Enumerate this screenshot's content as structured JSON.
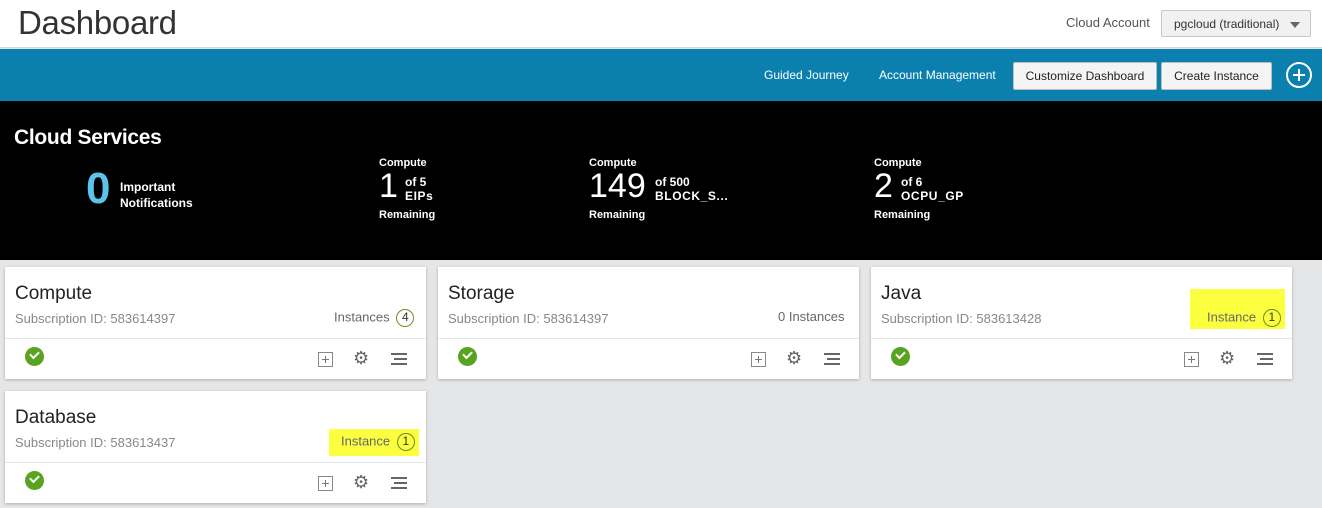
{
  "header": {
    "title": "Dashboard",
    "account_label": "Cloud Account",
    "account_value": "pgcloud (traditional)"
  },
  "nav": {
    "guided_journey": "Guided Journey",
    "account_management": "Account Management",
    "customize_dashboard": "Customize Dashboard",
    "create_instance": "Create Instance"
  },
  "banner": {
    "title": "Cloud Services",
    "notifications_count": "0",
    "notifications_line1": "Important",
    "notifications_line2": "Notifications",
    "metrics": [
      {
        "service": "Compute",
        "value": "1",
        "of": "of 5",
        "resource": "EIPs",
        "remaining": "Remaining"
      },
      {
        "service": "Compute",
        "value": "149",
        "of": "of 500",
        "resource": "BLOCK_S...",
        "remaining": "Remaining"
      },
      {
        "service": "Compute",
        "value": "2",
        "of": "of 6",
        "resource": "OCPU_GP",
        "remaining": "Remaining"
      }
    ]
  },
  "cards": [
    {
      "title": "Compute",
      "subscription": "Subscription ID: 583614397",
      "instances_label": "Instances",
      "instances_count": "4"
    },
    {
      "title": "Storage",
      "subscription": "Subscription ID: 583614397",
      "instances_label": "0 Instances",
      "instances_count": ""
    },
    {
      "title": "Java",
      "subscription": "Subscription ID: 583613428",
      "instances_label": "Instance",
      "instances_count": "1"
    },
    {
      "title": "Database",
      "subscription": "Subscription ID: 583613437",
      "instances_label": "Instance",
      "instances_count": "1"
    }
  ],
  "colors": {
    "nav_blue": "#0b7fae",
    "banner_black": "#000000",
    "accent_cyan": "#5cc3ec",
    "ok_green": "#5aa321",
    "highlight_yellow": "#fbff40"
  }
}
